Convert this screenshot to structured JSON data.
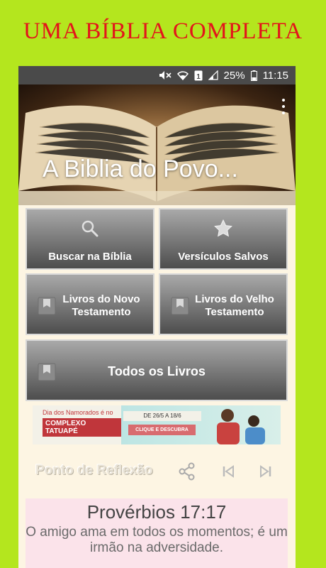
{
  "promo": {
    "title": "UMA BÍBLIA COMPLETA"
  },
  "statusbar": {
    "battery": "25%",
    "time": "11:15",
    "sim": "1"
  },
  "header": {
    "title": "A Biblia do Povo..."
  },
  "tiles": {
    "search": "Buscar na Bíblia",
    "saved": "Versículos Salvos",
    "new_testament": "Livros do Novo Testamento",
    "old_testament": "Livros do Velho Testamento",
    "all_books": "Todos os Livros"
  },
  "ad": {
    "line1": "Dia dos Namorados é no",
    "brand": "COMPLEXO TATUAPÉ",
    "date": "DE 26/5 A 18/6",
    "cta": "CLIQUE E DESCUBRA"
  },
  "reflection": {
    "title": "Ponto de Reflexão",
    "reference": "Provérbios 17:17",
    "text": "O amigo ama em todos os momentos; é um irmão na adversidade."
  },
  "colors": {
    "background": "#b4e61e",
    "promo_text": "#e3141b",
    "tile_top": "#a9a9a9",
    "tile_bottom": "#4d4d4d",
    "verse_bg": "#fbe3ea"
  }
}
